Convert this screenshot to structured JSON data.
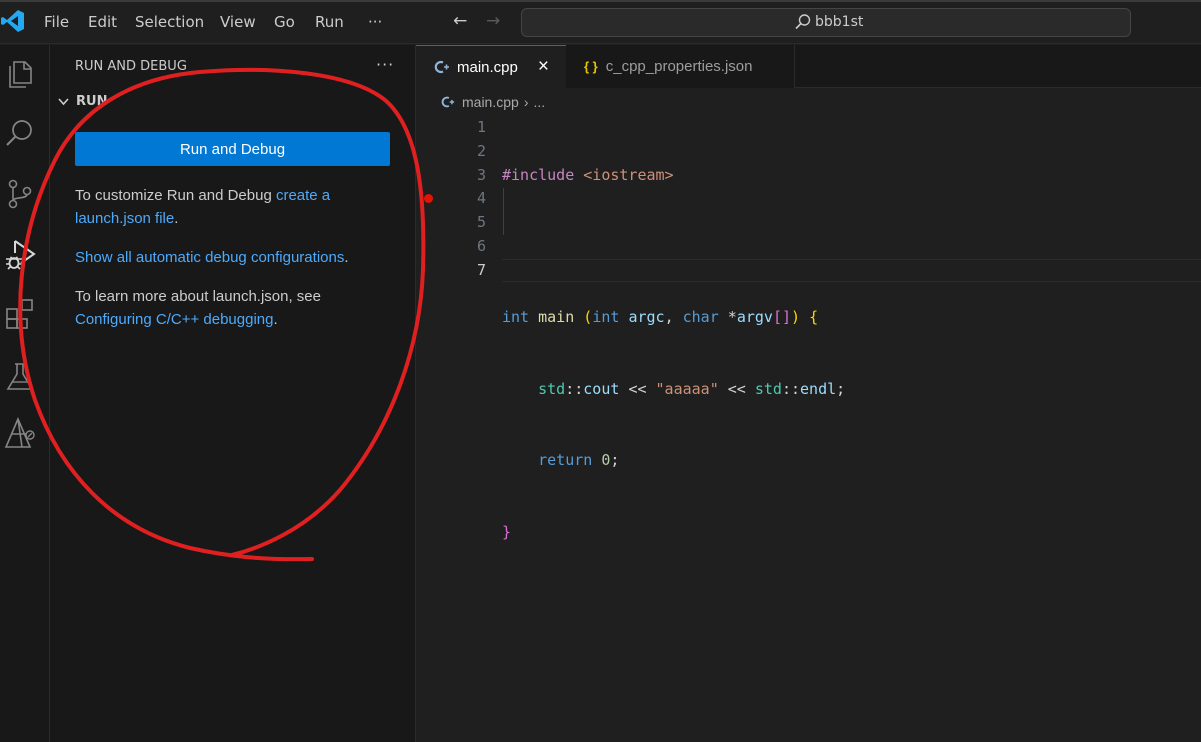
{
  "titlebar": {
    "menu": [
      "File",
      "Edit",
      "Selection",
      "View",
      "Go",
      "Run",
      "···"
    ],
    "search_text": "bbb1st"
  },
  "activitybar": {
    "icons": [
      "explorer-icon",
      "search-icon",
      "source-control-icon",
      "run-debug-icon",
      "extensions-icon",
      "testing-icon",
      "remote-explorer-icon"
    ]
  },
  "sidebar": {
    "title": "RUN AND DEBUG",
    "more": "···",
    "section": "RUN",
    "run_button": "Run and Debug",
    "customize_text": "To customize Run and Debug ",
    "customize_link": "create a launch.json file",
    "customize_end": ".",
    "show_link": "Show all automatic debug configurations",
    "show_end": ".",
    "learn_text": "To learn more about launch.json, see ",
    "learn_link": "Configuring C/C++ debugging",
    "learn_end": "."
  },
  "editor": {
    "tabs": [
      {
        "label": "main.cpp",
        "close": "×",
        "active": true
      },
      {
        "label": "c_cpp_properties.json",
        "icon": "{ }",
        "active": false
      }
    ],
    "breadcrumb": {
      "file": "main.cpp",
      "sep": "›",
      "more": "..."
    },
    "line_numbers": [
      "1",
      "2",
      "3",
      "4",
      "5",
      "6",
      "7"
    ],
    "code_lines": [
      "#include <iostream>",
      "",
      "int main (int argc, char *argv[]) {",
      "    std::cout << \"aaaaa\" << std::endl;",
      "    return 0;",
      "}",
      ""
    ]
  },
  "colors": {
    "accent": "#0078d4",
    "link": "#4daafc",
    "breakpoint": "#e51400",
    "annotation": "#e02020"
  }
}
